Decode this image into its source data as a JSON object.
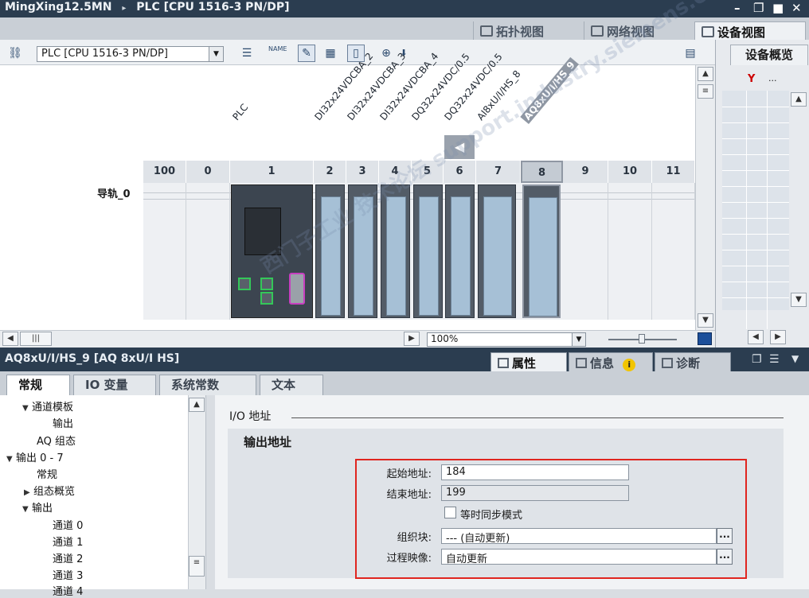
{
  "titlebar": {
    "project": "MingXing12.5MN",
    "breadcrumb_sep": "▸",
    "device": "PLC [CPU 1516-3 PN/DP]",
    "min": "–",
    "restore": "❐",
    "max": "■",
    "close": "✕"
  },
  "view_tabs": [
    {
      "label": "拓扑视图",
      "icon": "topology-icon"
    },
    {
      "label": "网络视图",
      "icon": "network-icon"
    },
    {
      "label": "设备视图",
      "icon": "device-icon",
      "active": true
    }
  ],
  "toolbar": {
    "device_select": "PLC [CPU 1516-3 PN/DP]",
    "name_icon_text": "NAME"
  },
  "canvas": {
    "rail_label": "导轨_0",
    "slots": [
      "100",
      "0",
      "1",
      "2",
      "3",
      "4",
      "5",
      "6",
      "7",
      "8",
      "9",
      "10",
      "11"
    ],
    "module_labels": [
      {
        "text": "PLC",
        "slot": "1"
      },
      {
        "text": "DI32x24VDCBA_2",
        "slot": "2"
      },
      {
        "text": "DI32x24VDCBA_3",
        "slot": "3"
      },
      {
        "text": "DI32x24VDCBA_4",
        "slot": "4"
      },
      {
        "text": "DQ32x24VDC/0.5",
        "slot": "5"
      },
      {
        "text": "DQ32x24VDC/0.5",
        "slot": "6"
      },
      {
        "text": "AI8xU/I/HS_8",
        "slot": "7"
      },
      {
        "text": "AQ8xU/I/HS_9",
        "slot": "8",
        "selected": true
      }
    ],
    "nav_arrow": "◀"
  },
  "zoom": {
    "value": "100%"
  },
  "overview": {
    "tab": "设备概览",
    "scroll_left": "◀",
    "scroll_right": "▶",
    "scroll_up": "▲",
    "scroll_down": "▼"
  },
  "properties": {
    "title": "AQ8xU/I/HS_9 [AQ 8xU/I HS]",
    "tabs": [
      {
        "label": "属性",
        "active": true
      },
      {
        "label": "信息"
      },
      {
        "label": "诊断"
      }
    ],
    "info_badge": "i",
    "subtabs": [
      {
        "label": "常规",
        "active": true
      },
      {
        "label": "IO 变量"
      },
      {
        "label": "系统常数"
      },
      {
        "label": "文本"
      }
    ]
  },
  "tree": [
    {
      "label": "通道模板",
      "indent": 1,
      "arrow": "▼"
    },
    {
      "label": "输出",
      "indent": 3,
      "arrow": ""
    },
    {
      "label": "AQ 组态",
      "indent": 2,
      "arrow": ""
    },
    {
      "label": "输出 0 - 7",
      "indent": 0,
      "arrow": "▼"
    },
    {
      "label": "常规",
      "indent": 2,
      "arrow": ""
    },
    {
      "label": "组态概览",
      "indent": 1,
      "arrow": "▶"
    },
    {
      "label": "输出",
      "indent": 1,
      "arrow": "▼"
    },
    {
      "label": "通道 0",
      "indent": 3,
      "arrow": ""
    },
    {
      "label": "通道 1",
      "indent": 3,
      "arrow": ""
    },
    {
      "label": "通道 2",
      "indent": 3,
      "arrow": ""
    },
    {
      "label": "通道 3",
      "indent": 3,
      "arrow": ""
    },
    {
      "label": "通道 4",
      "indent": 3,
      "arrow": ""
    }
  ],
  "io": {
    "section": "I/O 地址",
    "group": "输出地址",
    "start_label": "起始地址:",
    "start_value": "184",
    "end_label": "结束地址:",
    "end_value": "199",
    "iso_label": "等时同步模式",
    "ob_label": "组织块:",
    "ob_value": "--- (自动更新)",
    "pip_label": "过程映像:",
    "pip_value": "自动更新",
    "ellipsis": "..."
  },
  "watermark": "西门子工业  技术论坛  support.industry.siemens.com/cs"
}
